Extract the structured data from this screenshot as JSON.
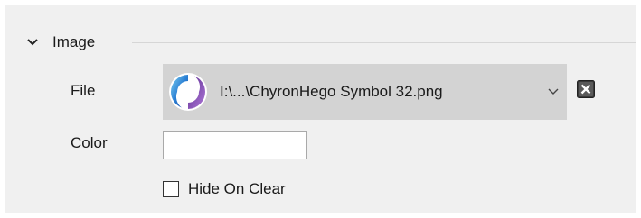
{
  "section": {
    "title": "Image",
    "expanded": true,
    "toggle_icon": "chevron-down-icon"
  },
  "file": {
    "label": "File",
    "value": "I:\\...\\ChyronHego Symbol 32.png",
    "thumbnail_icon": "chyronhego-logo-icon",
    "dropdown_icon": "chevron-down-icon",
    "clear_icon": "close-box-icon"
  },
  "color": {
    "label": "Color",
    "value": "#ffffff"
  },
  "hide_on_clear": {
    "label": "Hide On Clear",
    "checked": false
  },
  "colors": {
    "panel_bg": "#f0f0f0",
    "dropdown_bg": "#d3d3d3",
    "logo_blue": "#2a7fd4",
    "logo_purple": "#7a3fb0"
  }
}
